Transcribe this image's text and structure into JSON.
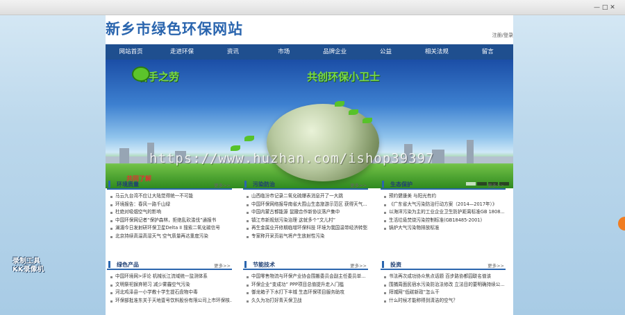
{
  "window": {
    "controls": "—  □  ✕"
  },
  "site": {
    "title": "新乡市绿色环保网站",
    "login": "注册/登录"
  },
  "nav": [
    "网站首页",
    "走进环保",
    "资讯",
    "市场",
    "品牌企业",
    "公益",
    "相关法规",
    "留言"
  ],
  "banner": {
    "left_text": "着手之劳",
    "right_text": "共创环保小卫士",
    "caption": "共同了解"
  },
  "watermark": "https://www.huzhan.com/ishop39397",
  "recorder": {
    "line1": "录制工具",
    "line2": "KK录像机"
  },
  "sections": [
    {
      "title": "环境质量",
      "more": "更多>>",
      "items": [
        "马云九台湾不应让大陆觉得统一不可能",
        "环境报告：春风一路千山绿",
        "杜绝对吸烟空气的影响",
        "中国环保网记者“保护森林，拒绝乱砍滥伐”通报书",
        "澜湄今日发射研环保卫星Delta II 搜索二氧化碳信号",
        "北京持续高温高湿天气 空气质量再达重度污染"
      ]
    },
    {
      "title": "污染防治",
      "more": "更多>>",
      "items": [
        "山西临汾市记录二氧化硫爆表消息开了一大跳",
        "中国环保网络报导南省大围山生态旅游示范区 获得天气...",
        "中国内蒙古都能源 鼠撤合作新协议落户集中",
        "镇江市新规划污染治理 这就多个“文儿村”",
        "再生金属业开修期临增环保科技 环境为我国温带经济转型...",
        "专家称开采页岩气将产生放射性污染"
      ]
    },
    {
      "title": "生态保护",
      "more": "更多>>",
      "items": [
        "预约健康美 与阳光有约",
        "《广东省大气污染防治行动方案（2014—2017年）》",
        "以海洋污染为主的工业企业卫生防护距离标准GB 1808...",
        "生活垃圾焚烧污染控制标准(GB18485-2001)",
        "锅炉大气污染物排放标准"
      ]
    },
    {
      "title": "绿色产品",
      "more": "更多>>",
      "items": [
        "中国环境网>评论 机械长江流域统一监测体系",
        "文明祭祀摒弃陋习 减少雾霾空气污染",
        "河北鸡泽县一小学教十学生提石盘物中毒",
        "环保部批准东关于天地壹号饮料股份有限公司上市环保核..."
      ]
    },
    {
      "title": "节能技术",
      "more": "更多>>",
      "items": [
        "中国零售物流与环保产业协会围搬委员会副主任委员单...",
        "环保企业“变成功” PPP项目总值提升走入门槛",
        "御龙箱子下水打下丰城 生态环保项目服务助攻",
        "久久为功打好青天保卫战"
      ]
    },
    {
      "title": "投资",
      "more": "更多>>",
      "items": [
        "书法再次成功协众焦点话题 百步路协都园联名值该",
        "围捕周面民宿水污染防治法修改 立法目的要明确持续公...",
        "拜城网“低碳新政”怎么干",
        "什么时候才能称得到清洁的空气？"
      ]
    }
  ]
}
